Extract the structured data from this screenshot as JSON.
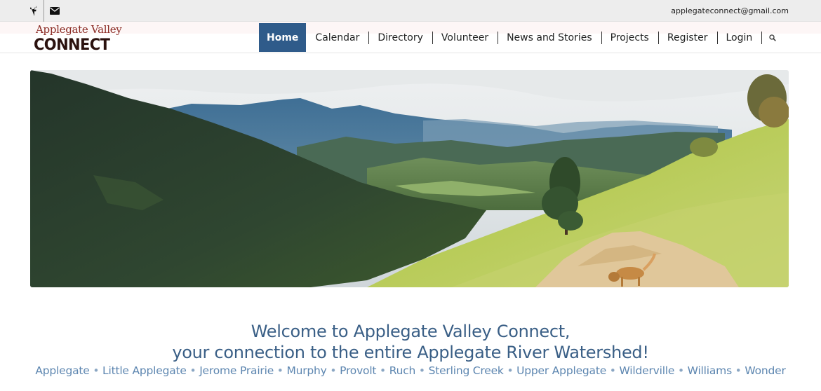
{
  "topbar": {
    "social": [
      {
        "name": "facebook-icon",
        "glyph": "f"
      },
      {
        "name": "mail-icon",
        "glyph": "✉"
      }
    ],
    "email": "applegateconnect@gmail.com"
  },
  "logo": {
    "line1": "Applegate Valley",
    "line2": "CONNECT"
  },
  "nav": {
    "items": [
      {
        "label": "Home",
        "active": true
      },
      {
        "label": "Calendar"
      },
      {
        "label": "Directory"
      },
      {
        "label": "Volunteer"
      },
      {
        "label": "News and Stories"
      },
      {
        "label": "Projects"
      },
      {
        "label": "Register"
      },
      {
        "label": "Login"
      }
    ],
    "search_icon": "search-icon"
  },
  "hero": {
    "image": "mountain-valley-landscape-with-dog-on-trail"
  },
  "welcome": {
    "line1": "Welcome to Applegate Valley Connect,",
    "line2": "your connection to the entire Applegate River Watershed!"
  },
  "communities": [
    "Applegate",
    "Little Applegate",
    "Jerome Prairie",
    "Murphy",
    "Provolt",
    "Ruch",
    "Sterling Creek",
    "Upper Applegate",
    "Wilderville",
    "Williams",
    "Wonder"
  ],
  "colors": {
    "accent": "#2f5b8a",
    "heading": "#3a5f86",
    "community_link": "#5d86b0",
    "logo_red": "#8b2b24"
  }
}
